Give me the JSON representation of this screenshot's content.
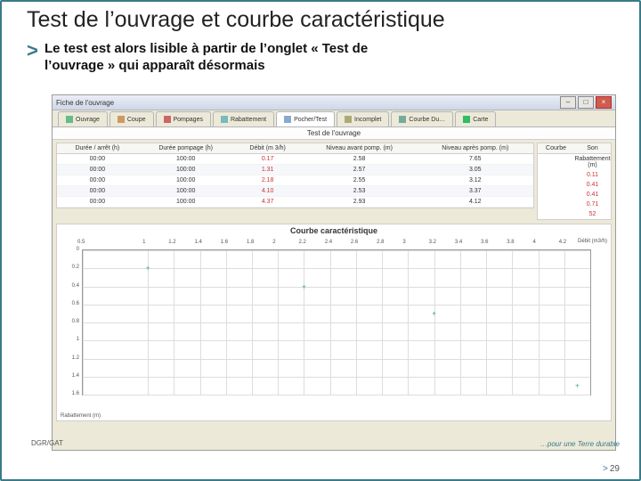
{
  "slide": {
    "title": "Test de l’ouvrage et courbe caractéristique",
    "bullet_marker": ">",
    "body_line1": "Le test est alors lisible à partir de l’onglet « Test de",
    "body_line2": "l’ouvrage » qui apparaît désormais",
    "footer_left": "DGR/GAT",
    "footer_page": "29",
    "tagline": "…pour une Terre durable"
  },
  "app": {
    "title": "Fiche de l'ouvrage",
    "tabs": [
      {
        "label": "Ouvrage"
      },
      {
        "label": "Coupe"
      },
      {
        "label": "Pompages"
      },
      {
        "label": "Rabattement"
      },
      {
        "label": "Pocher/Test"
      },
      {
        "label": "Incomplet"
      },
      {
        "label": "Courbe Du…"
      },
      {
        "label": "Carte"
      }
    ],
    "section_title": "Test de l'ouvrage",
    "side_panel_headers": {
      "col1": "Courbe",
      "col2": "Son"
    },
    "side_panel_row": {
      "col1": "",
      "col2": "Rabattement (m)"
    },
    "table": {
      "headers": [
        "Durée / arrêt (h)",
        "Durée pompage (h)",
        "Débit (m 3/h)",
        "Niveau avant pomp. (m)",
        "Niveau après pomp. (m)"
      ],
      "rows": [
        [
          "00:00",
          "100:00",
          "0.17",
          "2.58",
          "7.65"
        ],
        [
          "00:00",
          "100:00",
          "1.31",
          "2.57",
          "3.05"
        ],
        [
          "00:00",
          "100:00",
          "2.18",
          "2.55",
          "3.12"
        ],
        [
          "00:00",
          "100:00",
          "4.10",
          "2.53",
          "3.37"
        ],
        [
          "00:00",
          "100:00",
          "4.37",
          "2.93",
          "4.12"
        ]
      ],
      "right_values": [
        "0.11",
        "0.41",
        "0.41",
        "0.71",
        "52"
      ]
    },
    "chart_label": "Courbe caractéristique",
    "chart_top_right": "Débit (m3/h)",
    "chart_bottom_left": "Rabattement (m)"
  },
  "chart_data": {
    "type": "scatter",
    "title": "Courbe caractéristique",
    "xlabel": "Débit (m3/h)",
    "ylabel": "Rabattement (m)",
    "xticks": [
      0.5,
      1,
      1.2,
      1.4,
      1.6,
      1.8,
      2,
      2.2,
      2.4,
      2.6,
      2.8,
      3,
      3.2,
      3.4,
      3.6,
      3.8,
      4,
      4.2
    ],
    "yticks": [
      0,
      0.2,
      0.4,
      0.6,
      0.8,
      1,
      1.2,
      1.4,
      1.6
    ],
    "xlim": [
      0.5,
      4.4
    ],
    "ylim": [
      0,
      1.6
    ],
    "series": [
      {
        "name": "points",
        "x": [
          1.0,
          2.2,
          3.2,
          4.3
        ],
        "y": [
          0.2,
          0.4,
          0.7,
          1.5
        ]
      }
    ]
  }
}
